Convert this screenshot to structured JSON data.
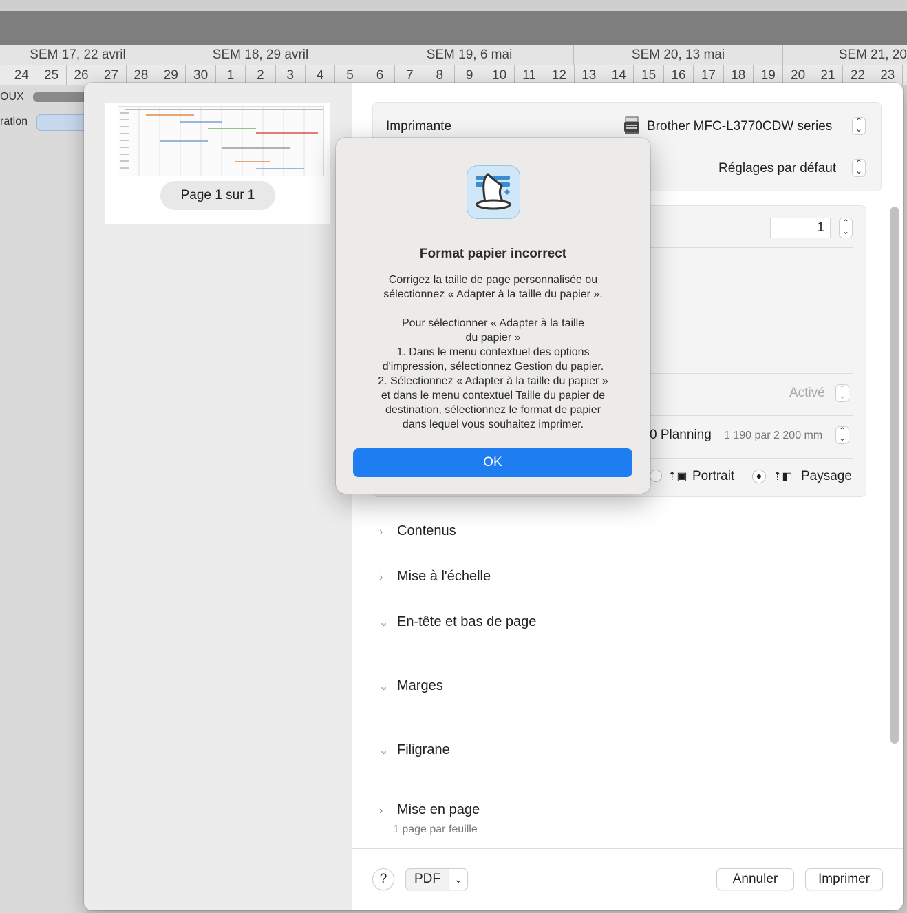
{
  "background": {
    "weeks": [
      "SEM 17, 22 avril",
      "SEM 18, 29 avril",
      "SEM 19, 6 mai",
      "SEM 20, 13 mai",
      "SEM 21, 20"
    ],
    "days": [
      "24",
      "25",
      "26",
      "27",
      "28",
      "29",
      "30",
      "1",
      "2",
      "3",
      "4",
      "5",
      "6",
      "7",
      "8",
      "9",
      "10",
      "11",
      "12",
      "13",
      "14",
      "15",
      "16",
      "17",
      "18",
      "19",
      "20",
      "21",
      "22",
      "23"
    ],
    "row1": "OUX",
    "row2": "ration"
  },
  "preview": {
    "page_label": "Page 1 sur 1"
  },
  "printer": {
    "label": "Imprimante",
    "name": "Brother MFC-L3770CDW series",
    "preset": "Réglages par défaut"
  },
  "options": {
    "copies": "1",
    "duplex_value": "Activé",
    "paper_name": "0 Planning",
    "paper_size": "1 190 par 2 200 mm",
    "portrait": "Portrait",
    "landscape": "Paysage"
  },
  "sections": {
    "contents": "Contenus",
    "scaling": "Mise à l'échelle",
    "header_footer": "En-tête et bas de page",
    "margins": "Marges",
    "watermark": "Filigrane",
    "layout": "Mise en page",
    "layout_sub": "1 page par feuille"
  },
  "footer": {
    "help": "?",
    "pdf": "PDF",
    "cancel": "Annuler",
    "print": "Imprimer"
  },
  "alert": {
    "title": "Format papier incorrect",
    "message": "Corrigez la taille de page personnalisée ou\nsélectionnez « Adapter à la taille du papier ».\n\nPour sélectionner « Adapter à la taille\ndu papier »\n1. Dans le menu contextuel des options\nd'impression, sélectionnez Gestion du papier.\n2. Sélectionnez « Adapter à la taille du papier »\net dans le menu contextuel Taille du papier de\ndestination, sélectionnez le format de papier\ndans lequel vous souhaitez imprimer.",
    "ok": "OK",
    "accent": "#1e7ef1"
  },
  "icons": [
    "printer-icon",
    "wizard-hat-icon",
    "chevron-right-icon",
    "chevron-down-icon",
    "portrait-icon",
    "landscape-icon"
  ]
}
